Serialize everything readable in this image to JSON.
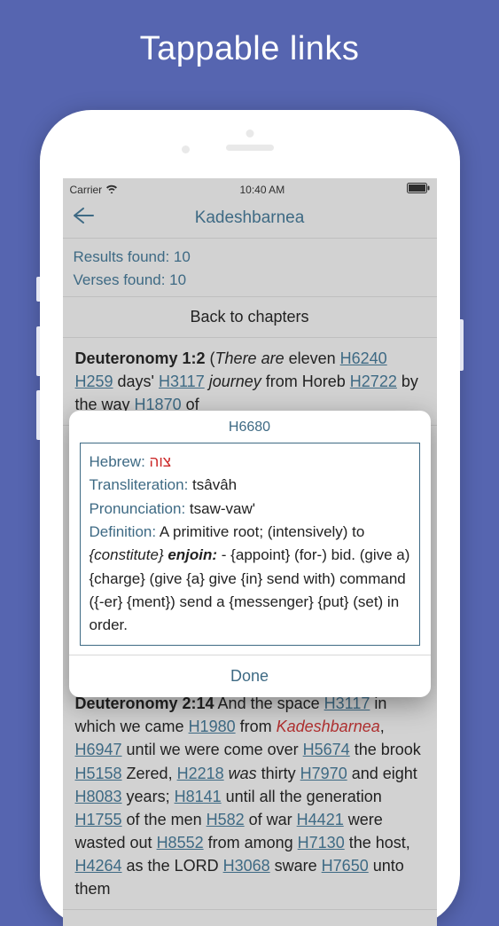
{
  "headline": "Tappable links",
  "statusbar": {
    "carrier": "Carrier",
    "time": "10:40 AM"
  },
  "nav": {
    "title": "Kadeshbarnea"
  },
  "meta": {
    "results": "Results found: 10",
    "verses": "Verses found: 10"
  },
  "back_to_chapters": "Back to chapters",
  "verse1": {
    "ref": "Deuteronomy 1:2",
    "pre": " (",
    "there_are": "There are",
    "t1": " eleven ",
    "h6240": "H6240",
    "sp": " ",
    "h259": "H259",
    "t2": " days' ",
    "h3117": "H3117",
    "journey": " journey",
    "t3": " from Horeb ",
    "h2722": "H2722",
    "t4": " by the way ",
    "h1870": "H1870",
    "t5": " of"
  },
  "popup": {
    "title": "H6680",
    "labels": {
      "hebrew": "Hebrew:",
      "translit": "Transliteration:",
      "pron": "Pronunciation:",
      "def": "Definition:"
    },
    "hebrew_word": "צוה",
    "translit": " tsâvâh",
    "pron": " tsaw-vaw'",
    "def_pre": " A primitive root; (intensively) to ",
    "def_i1": "{constitute}",
    "def_b": " enjoin:",
    "def_post": " - {appoint} (for-) bid. (give a) {charge} (give {a} give {in} send with) command ({-er} {ment}) send a {messenger} {put} (set) in order.",
    "done": "Done"
  },
  "verse2": {
    "ref": "Deuteronomy 2:14",
    "t1": " And the space ",
    "h3117": "H3117",
    "t2": " in which we came ",
    "h1980": "H1980",
    "t3": " from ",
    "kadesh": "Kadeshbarnea",
    "comma": ", ",
    "h6947": "H6947",
    "t4": " until we were come over ",
    "h5674": "H5674",
    "t5": " the brook ",
    "h5158": "H5158",
    "t6": " Zered, ",
    "h2218": "H2218",
    "was": " was",
    "t7": " thirty ",
    "h7970": "H7970",
    "t8": " and eight ",
    "h8083": "H8083",
    "t9": " years; ",
    "h8141": "H8141",
    "t10": " until all the generation ",
    "h1755": "H1755",
    "t11": " of the men ",
    "h582": "H582",
    "t12": " of war ",
    "h4421": "H4421",
    "t13": " were wasted out ",
    "h8552": "H8552",
    "t14": " from among ",
    "h7130": "H7130",
    "t15": " the host, ",
    "h4264": "H4264",
    "t16": " as the LORD ",
    "h3068": "H3068",
    "t17": " sware ",
    "h7650": "H7650",
    "t18": " unto them"
  }
}
